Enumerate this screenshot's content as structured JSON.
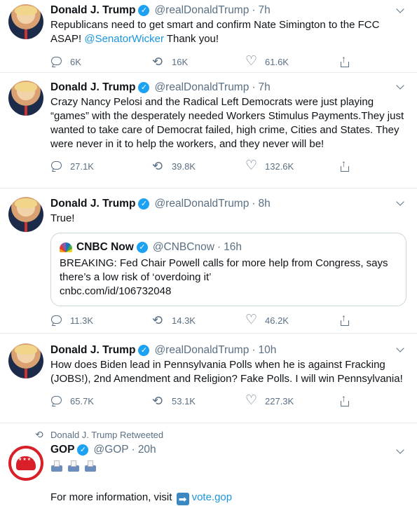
{
  "tweets": [
    {
      "name": "Donald J. Trump",
      "handle": "@realDonaldTrump",
      "time": "7h",
      "text_plain": "Republicans need to get smart and confirm Nate Simington to the FCC ASAP! ",
      "mention": "@SenatorWicker",
      "text_after": " Thank you!",
      "replies": "6K",
      "retweets": "16K",
      "likes": "61.6K"
    },
    {
      "name": "Donald J. Trump",
      "handle": "@realDonaldTrump",
      "time": "7h",
      "text": "Crazy Nancy Pelosi and the Radical Left Democrats were just playing “games” with the desperately needed Workers Stimulus Payments.They just wanted to take care of Democrat failed, high crime, Cities and States. They were never in it to help the workers, and they never will be!",
      "replies": "27.1K",
      "retweets": "39.8K",
      "likes": "132.6K"
    },
    {
      "name": "Donald J. Trump",
      "handle": "@realDonaldTrump",
      "time": "8h",
      "text": "True!",
      "quote": {
        "name": "CNBC Now",
        "handle": "@CNBCnow",
        "time": "16h",
        "text": "BREAKING: Fed Chair Powell calls for more help from Congress, says there’s a low risk of ‘overdoing it’",
        "link": "cnbc.com/id/106732048"
      },
      "replies": "11.3K",
      "retweets": "14.3K",
      "likes": "46.2K"
    },
    {
      "name": "Donald J. Trump",
      "handle": "@realDonaldTrump",
      "time": "10h",
      "text": "How does Biden lead in Pennsylvania Polls when he is against Fracking (JOBS!), 2nd Amendment and Religion? Fake Polls. I will win Pennsylvania!",
      "replies": "65.7K",
      "retweets": "53.1K",
      "likes": "227.3K"
    },
    {
      "retweeted_by": "Donald J. Trump Retweeted",
      "name": "GOP",
      "handle": "@GOP",
      "time": "20h",
      "emojis": [
        "ballot-box-icon",
        "ballot-box-icon",
        "ballot-box-icon"
      ],
      "text_prefix": "For more information, visit",
      "link": "vote.gop"
    }
  ],
  "colors": {
    "link": "#1b95e0",
    "verified": "#1da1f2",
    "muted": "#5b7083",
    "gop_red": "#d91f27"
  },
  "icons": {
    "reply": "reply-icon",
    "retweet": "retweet-icon",
    "like": "heart-icon",
    "share": "share-icon",
    "more": "chevron-down-icon",
    "verified": "verified-badge-icon"
  }
}
